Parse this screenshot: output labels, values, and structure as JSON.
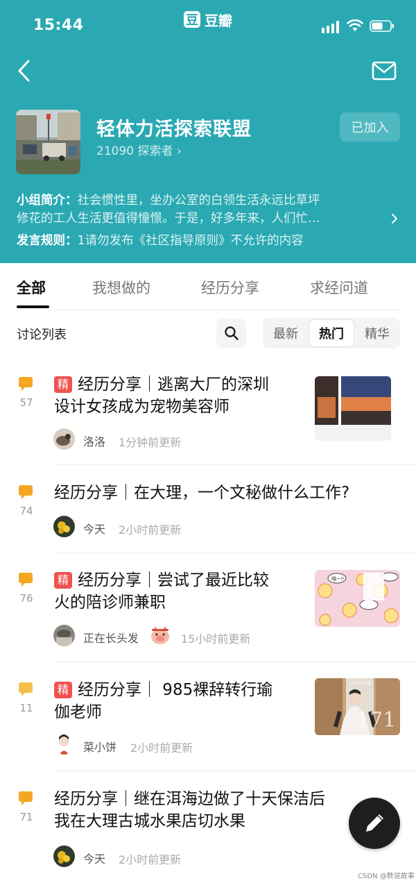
{
  "status_bar": {
    "time": "15:44",
    "app_name": "豆瓣",
    "app_logo_char": "豆"
  },
  "group": {
    "name": "轻体力活探索联盟",
    "member_count": "21090 探索者 ›",
    "join_status": "已加入",
    "intro_label": "小组简介：",
    "intro_line1": "社会惯性里，坐办公室的白领生活永远比草坪",
    "intro_line2": "修花的工人生活更值得憧憬。于是，好多年来，人们忙…",
    "rules_label": "发言规则：",
    "rules_text": "1请勿发布《社区指导原则》不允许的内容"
  },
  "tabs": [
    "全部",
    "我想做的",
    "经历分享",
    "求经问道"
  ],
  "active_tab": "全部",
  "list": {
    "title": "讨论列表",
    "sort_options": [
      "最新",
      "热门",
      "精华"
    ],
    "active_sort": "热门"
  },
  "badge_label": "精",
  "posts": [
    {
      "comments": "57",
      "featured": true,
      "title_line1": "经历分享｜逃离大厂的深圳",
      "title_line2": "设计女孩成为宠物美容师",
      "author": "洛洛",
      "time": "1分钟前更新"
    },
    {
      "comments": "74",
      "featured": false,
      "title_line1": "经历分享｜在大理，一个文秘做什么工作?",
      "title_line2": "",
      "author": "今天",
      "time": "2小时前更新"
    },
    {
      "comments": "76",
      "featured": true,
      "title_line1": "经历分享｜尝试了最近比较",
      "title_line2": "火的陪诊师兼职",
      "author": "正在长头发",
      "time": "15小时前更新"
    },
    {
      "comments": "11",
      "featured": true,
      "title_line1": "经历分享｜ 985裸辞转行瑜",
      "title_line2": "伽老师",
      "author": "菜小饼",
      "time": "2小时前更新"
    },
    {
      "comments": "71",
      "featured": false,
      "title_line1": "经历分享｜继在洱海边做了十天保洁后",
      "title_line2": "我在大理古城水果店切水果",
      "author": "今天",
      "time": "2小时前更新"
    }
  ],
  "thumb_texts": {
    "sticker_text": "喵~!!",
    "gym_text": "Free life 已经"
  },
  "watermark": "CSDN @数说故事",
  "colors": {
    "header_bg": "#2aa9b3",
    "comment_icon": "#f5a623",
    "featured_badge": "#ef5350"
  }
}
